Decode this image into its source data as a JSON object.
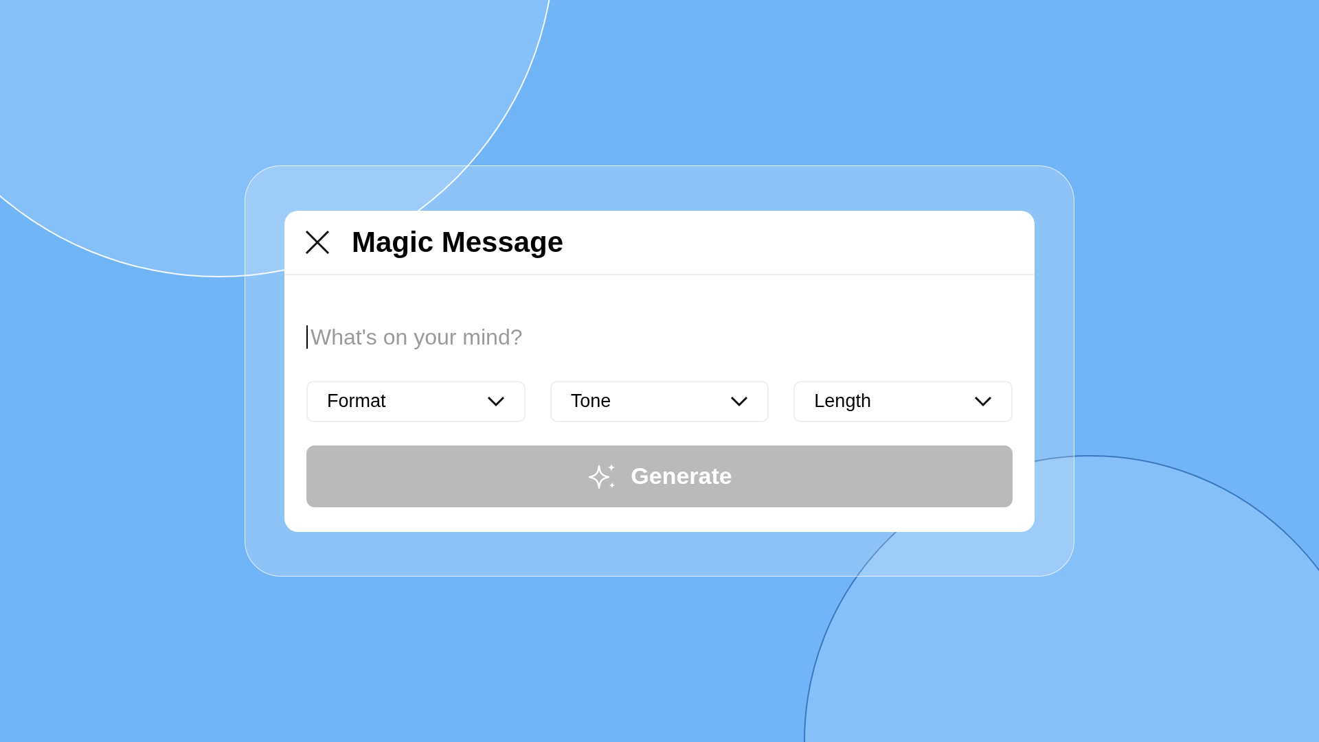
{
  "dialog": {
    "title": "Magic Message",
    "message_field": {
      "placeholder": "What's on your mind?",
      "focused": true
    },
    "dropdowns": [
      {
        "label": "Format"
      },
      {
        "label": "Tone"
      },
      {
        "label": "Length"
      }
    ],
    "generate_button": {
      "label": "Generate",
      "disabled": true
    }
  }
}
